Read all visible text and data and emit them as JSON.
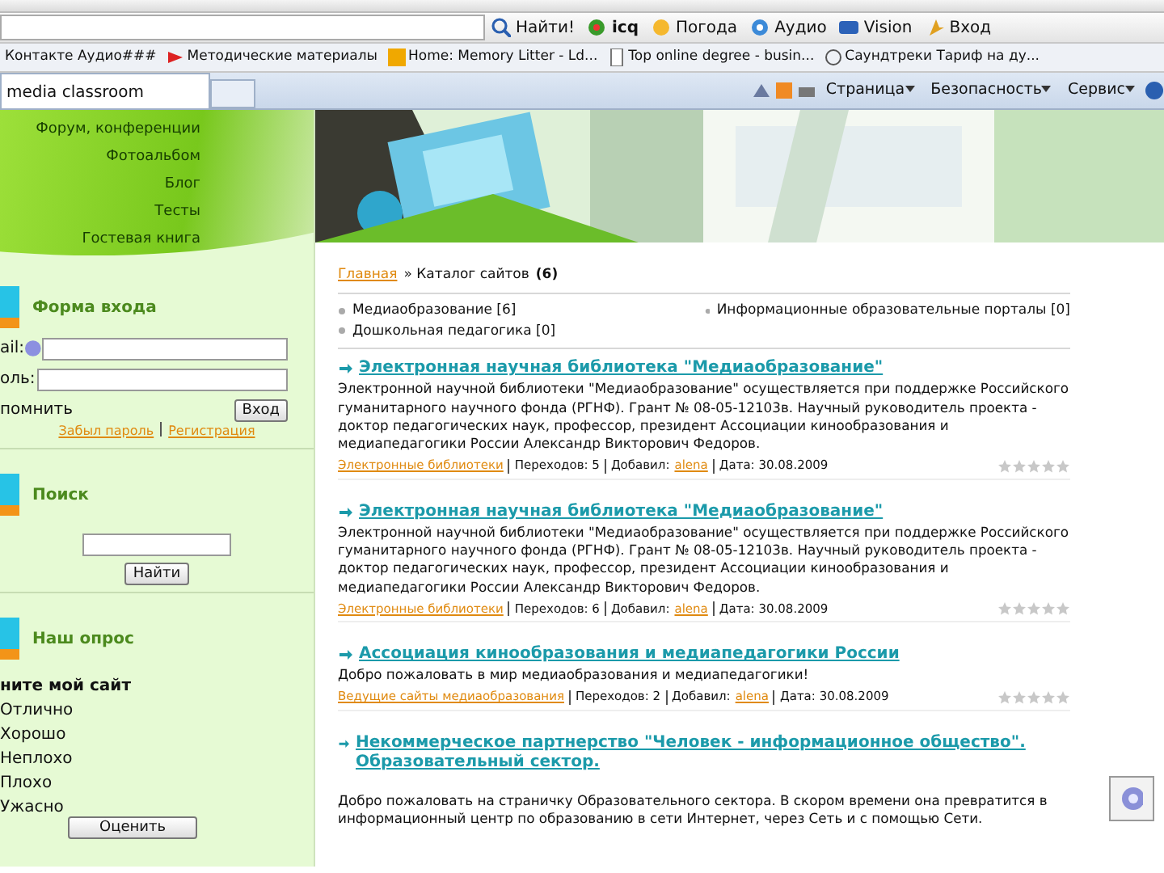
{
  "browser": {
    "toolbar": [
      {
        "kind": "find",
        "label": "Найти!"
      },
      {
        "kind": "icq",
        "label": "icq"
      },
      {
        "kind": "weather",
        "label": "Погода"
      },
      {
        "kind": "audio",
        "label": "Аудио"
      },
      {
        "kind": "vision",
        "label": "Vision"
      },
      {
        "kind": "login",
        "label": "Вход"
      }
    ],
    "bookmarks": [
      "Контакте Аудио###",
      "Методические материалы",
      "Home: Memory Litter - Ld...",
      "Top online degree - busin...",
      "Саундтреки Тариф на ду..."
    ],
    "tab": {
      "title": "media classroom"
    },
    "commands": [
      "Страница",
      "Безопасность",
      "Сервис"
    ]
  },
  "sidebar": {
    "menu": [
      "Форум, конференции",
      "Фотоальбом",
      "Блог",
      "Тесты",
      "Гостевая книга"
    ],
    "login": {
      "title": "Форма входа",
      "fields": [
        "ail:",
        "оль:"
      ],
      "remember": "помнить",
      "button": "Вход",
      "links": [
        "Забыл пароль",
        "Регистрация"
      ]
    },
    "search": {
      "title": "Поиск",
      "button": "Найти"
    },
    "poll": {
      "title": "Наш опрос",
      "question": "ните мой сайт",
      "options": [
        "Отлично",
        "Хорошо",
        "Неплохо",
        "Плохо",
        "Ужасно"
      ],
      "button": "Оценить"
    }
  },
  "content": {
    "breadcrumb": {
      "link": "Главная",
      "current": "» Каталог сайтов",
      "count": "(6)"
    },
    "categories": [
      "Медиаобразование [6]",
      "Информационные образовательные порталы [0]",
      "Дошкольная педагогика [0]"
    ],
    "entries": [
      {
        "title": "Электронная научная библиотека \"Медиаобразование\"",
        "text": "Электронной научной библиотеки \"Медиаобразование\" осуществляется при поддержке Российского гуманитарного научного фонда (РГНФ). Грант № 08-05-12103в. Научный руководитель проекта - доктор педагогических наук, профессор, президент Ассоциации кинообразования и медиапедагогики России Александр Викторович Федоров.",
        "category": "Электронные библиотеки",
        "visits": "Переходов: 5",
        "added_label": "Добавил:",
        "author": "alena",
        "date": "Дата: 30.08.2009",
        "stars": 0
      },
      {
        "title": "Электронная научная библиотека \"Медиаобразование\"",
        "text": "Электронной научной библиотеки \"Медиаобразование\" осуществляется при поддержке Российского гуманитарного научного фонда (РГНФ). Грант № 08-05-12103в. Научный руководитель проекта - доктор педагогических наук, профессор, президент Ассоциации кинообразования и медиапедагогики России Александр Викторович Федоров.",
        "category": "Электронные библиотеки",
        "visits": "Переходов: 6",
        "added_label": "Добавил:",
        "author": "alena",
        "date": "Дата: 30.08.2009",
        "stars": 0
      },
      {
        "title": "Ассоциация кинообразования и медиапедагогики России",
        "text": "Добро пожаловать в мир медиаобразования и медиапедагогики!",
        "category": "Ведущие сайты медиаобразования",
        "visits": "Переходов: 2",
        "added_label": "Добавил:",
        "author": "alena",
        "date": "Дата: 30.08.2009",
        "stars": 0
      },
      {
        "title": "Некоммерческое партнерство \"Человек - информационное общество\". Образовательный сектор.",
        "text": "Добро пожаловать на страничку Образовательного сектора. В скором времени она превратится в информационный центр по образованию в сети Интернет, через Сеть и с помощью Сети."
      }
    ]
  }
}
